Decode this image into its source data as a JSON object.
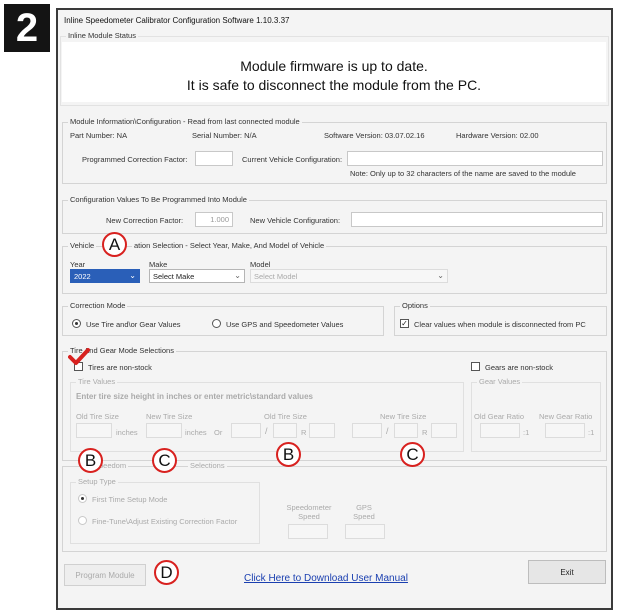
{
  "step": "2",
  "app_title": "Inline Speedometer Calibrator Configuration Software 1.10.3.37",
  "status": {
    "legend": "Inline Module Status",
    "line1": "Module firmware is up to date.",
    "line2": "It is safe to disconnect the module from the PC."
  },
  "module_info": {
    "legend": "Module Information\\Configuration - Read from last connected module",
    "part_number": "Part Number: NA",
    "serial_number": "Serial Number: N/A",
    "software_version": "Software Version: 03.07.02.16",
    "hardware_version": "Hardware Version: 02.00",
    "programmed_cf_label": "Programmed Correction Factor:",
    "current_vehicle_label": "Current Vehicle Configuration:",
    "note": "Note: Only up to 32 characters of the name are saved to the module"
  },
  "config_values": {
    "legend": "Configuration Values To Be Programmed Into Module",
    "new_cf_label": "New Correction Factor:",
    "new_cf_value": "1.000",
    "new_vehicle_label": "New Vehicle Configuration:"
  },
  "vehicle_selection": {
    "legend_prefix": "Vehicle",
    "legend_suffix": "ation Selection - Select Year, Make, And Model of Vehicle",
    "year_label": "Year",
    "year_value": "2022",
    "make_label": "Make",
    "make_value": "Select Make",
    "model_label": "Model",
    "model_value": "Select Model"
  },
  "correction_mode": {
    "legend": "Correction Mode",
    "opt1": "Use Tire and\\or Gear Values",
    "opt2": "Use GPS and Speedometer Values"
  },
  "options": {
    "legend": "Options",
    "clear_label": "Clear values when module is disconnected from PC"
  },
  "tire_gear": {
    "legend": "Tire And Gear Mode Selections",
    "tires_nonstock": "Tires are non-stock",
    "gears_nonstock": "Gears are non-stock",
    "tire_values_legend": "Tire Values",
    "instruction": "Enter tire size height in inches or enter metric\\standard values",
    "old_tire_size": "Old Tire Size",
    "new_tire_size": "New Tire Size",
    "inches": "inches",
    "or": "Or",
    "slash": "/",
    "r": "R",
    "gear_values_legend": "Gear Values",
    "old_gear_ratio": "Old Gear Ratio",
    "new_gear_ratio": "New Gear Ratio",
    "ratio_suffix": ":1"
  },
  "gps_speedo": {
    "legend_a": "Speedom",
    "legend_b": "Selections",
    "setup_type_legend": "Setup Type",
    "first_time": "First Time Setup Mode",
    "fine_tune": "Fine-Tune\\Adjust Existing Correction Factor",
    "speedometer_speed": "Speedometer Speed",
    "gps_speed": "GPS Speed"
  },
  "buttons": {
    "program": "Program Module",
    "exit": "Exit",
    "download": "Click Here to Download User Manual"
  },
  "callouts": {
    "a": "A",
    "b": "B",
    "c": "C",
    "d": "D"
  },
  "colors": {
    "callout_border": "#d8211f",
    "checkmark": "#d8211f",
    "selection": "#2a5fb8",
    "link": "#1a3fb0"
  }
}
